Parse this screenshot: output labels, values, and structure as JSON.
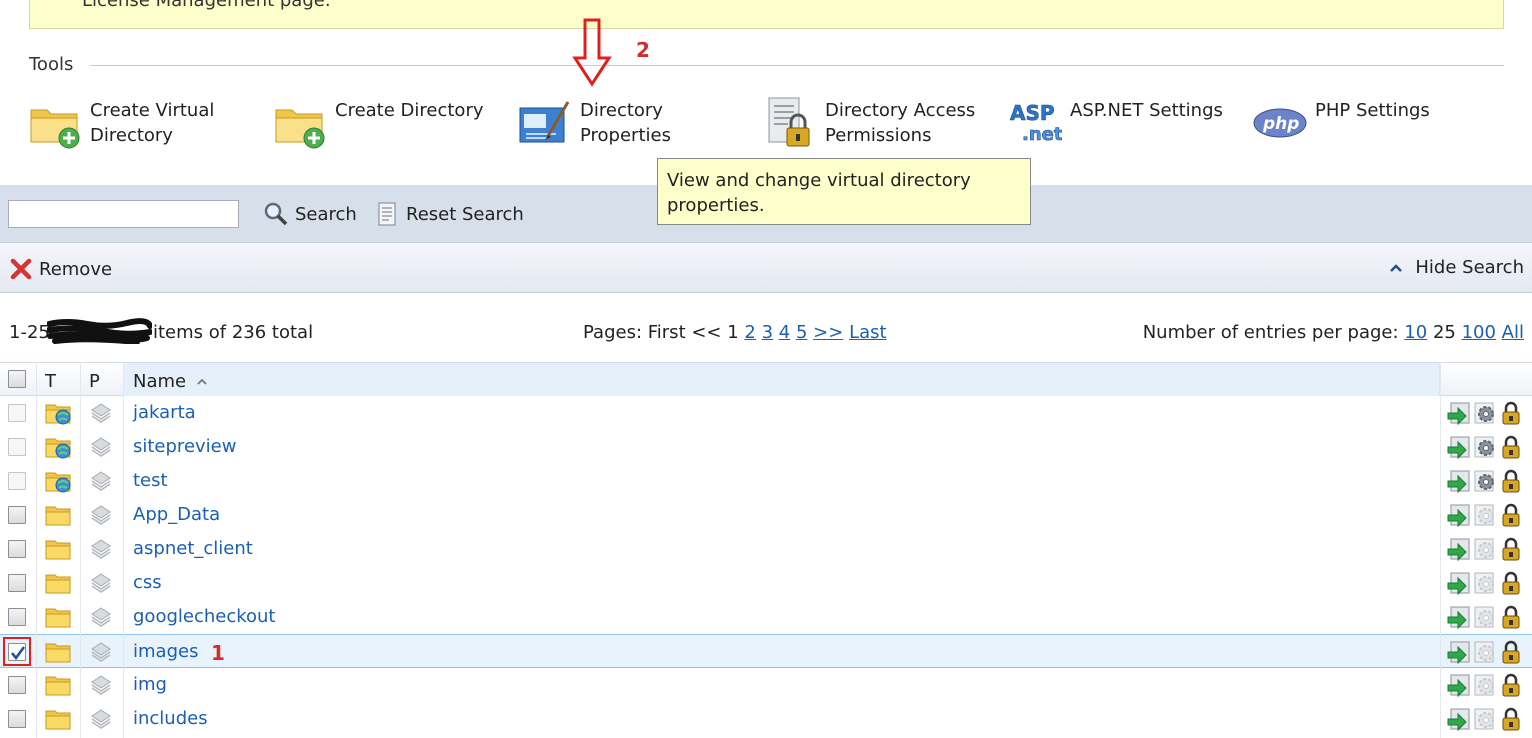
{
  "banner": {
    "text": "License Management page."
  },
  "tools": {
    "title": "Tools",
    "items": [
      {
        "line1": "Create Virtual",
        "line2": "Directory",
        "icon": "folder-add-icon"
      },
      {
        "line1": "Create Directory",
        "line2": "",
        "icon": "folder-add-icon"
      },
      {
        "line1": "Directory",
        "line2": "Properties",
        "icon": "directory-properties-icon"
      },
      {
        "line1": "Directory Access",
        "line2": "Permissions",
        "icon": "lock-document-icon"
      },
      {
        "line1": "ASP.NET Settings",
        "line2": "",
        "icon": "aspnet-logo-icon"
      },
      {
        "line1": "PHP Settings",
        "line2": "",
        "icon": "php-logo-icon"
      }
    ]
  },
  "annotations": {
    "arrow_label": "2",
    "row_label": "1",
    "color": "#d42b2b"
  },
  "tooltip": {
    "line1": "View and change virtual directory",
    "line2": "properties."
  },
  "search": {
    "value": "",
    "search_label": "Search",
    "reset_label": "Reset Search"
  },
  "actions": {
    "remove_label": "Remove",
    "hide_search_label": "Hide Search"
  },
  "pager": {
    "count_prefix": "1-25",
    "count_suffix": "items of 236 total",
    "pages_label": "Pages: First << 1",
    "page_links": [
      "2",
      "3",
      "4",
      "5",
      ">>",
      "Last"
    ],
    "entries_label": "Number of entries per page:",
    "entries_options": [
      "10",
      "25",
      "100",
      "All"
    ],
    "entries_selected": "25"
  },
  "grid": {
    "columns": {
      "type": "T",
      "perm": "P",
      "name": "Name"
    },
    "rows": [
      {
        "name": "jakarta",
        "type_icon": "virtual-directory-icon",
        "checked": false,
        "settings_active": true
      },
      {
        "name": "sitepreview",
        "type_icon": "virtual-directory-icon",
        "checked": false,
        "settings_active": true
      },
      {
        "name": "test",
        "type_icon": "virtual-directory-icon",
        "checked": false,
        "settings_active": true
      },
      {
        "name": "App_Data",
        "type_icon": "folder-icon",
        "checked": false,
        "settings_active": false
      },
      {
        "name": "aspnet_client",
        "type_icon": "folder-icon",
        "checked": false,
        "settings_active": false
      },
      {
        "name": "css",
        "type_icon": "folder-icon",
        "checked": false,
        "settings_active": false
      },
      {
        "name": "googlecheckout",
        "type_icon": "folder-icon",
        "checked": false,
        "settings_active": false
      },
      {
        "name": "images",
        "type_icon": "folder-icon",
        "checked": true,
        "settings_active": false
      },
      {
        "name": "img",
        "type_icon": "folder-icon",
        "checked": false,
        "settings_active": false
      },
      {
        "name": "includes",
        "type_icon": "folder-icon",
        "checked": false,
        "settings_active": false
      }
    ]
  }
}
